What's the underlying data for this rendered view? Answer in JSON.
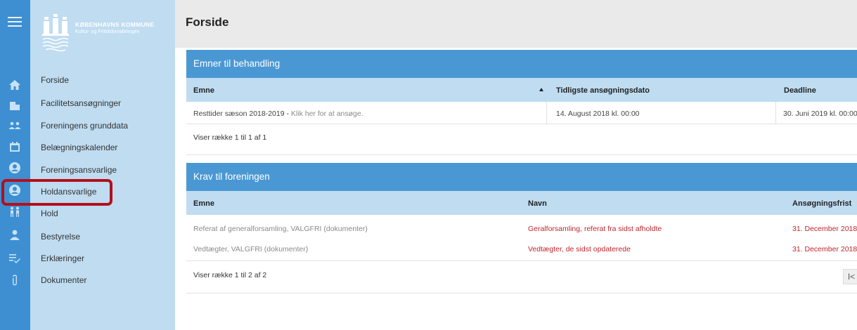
{
  "org": {
    "name": "KØBENHAVNS KOMMUNE",
    "department": "Kultur- og Fritidsforvaltningen"
  },
  "rail": {
    "icons": [
      "hamburger-icon",
      "home-icon",
      "building-icon",
      "group-icon",
      "calendar-icon",
      "user-circle-icon",
      "user-circle-icon",
      "people-icon",
      "person-icon",
      "list-check-icon",
      "paperclip-icon"
    ]
  },
  "menu": {
    "items": [
      {
        "label": "Forside"
      },
      {
        "label": "Facilitetsansøgninger"
      },
      {
        "label": "Foreningens grunddata"
      },
      {
        "label": "Belægningskalender"
      },
      {
        "label": "Foreningsansvarlige"
      },
      {
        "label": "Holdansvarlige"
      },
      {
        "label": "Hold"
      },
      {
        "label": "Bestyrelse"
      },
      {
        "label": "Erklæringer"
      },
      {
        "label": "Dokumenter"
      }
    ]
  },
  "page": {
    "title": "Forside"
  },
  "emner": {
    "title": "Emner til behandling",
    "columns": [
      "Emne",
      "Tidligste ansøgningsdato",
      "Deadline"
    ],
    "rows": [
      {
        "emne": "Resttider sæson 2018-2019 - ",
        "link": "Klik her for at ansøge.",
        "date": "14. August 2018 kl. 00:00",
        "deadline": "30. Juni 2019 kl. 00:00"
      }
    ],
    "footer": "Viser række 1 til 1 af 1"
  },
  "krav": {
    "title": "Krav til foreningen",
    "columns": [
      "Emne",
      "Navn",
      "Ansøgningsfrist"
    ],
    "rows": [
      {
        "emne": "Referat af generalforsamling, VALGFRI (dokumenter)",
        "navn": "Geralforsamling, referat fra sidst afholdte",
        "frist": "31. December 2018"
      },
      {
        "emne": "Vedtægter, VALGFRI (dokumenter)",
        "navn": "Vedtægter, de sidst opdaterede",
        "frist": "31. December 2018"
      }
    ],
    "footer": "Viser række 1 til 2 af 2",
    "pager_first": "I<"
  },
  "colors": {
    "rail": "#3d8fd1",
    "sidebar": "#bfdcf1",
    "panel_header": "#4a98d3",
    "link_red": "#c0262d",
    "highlight": "#b40f1c"
  }
}
